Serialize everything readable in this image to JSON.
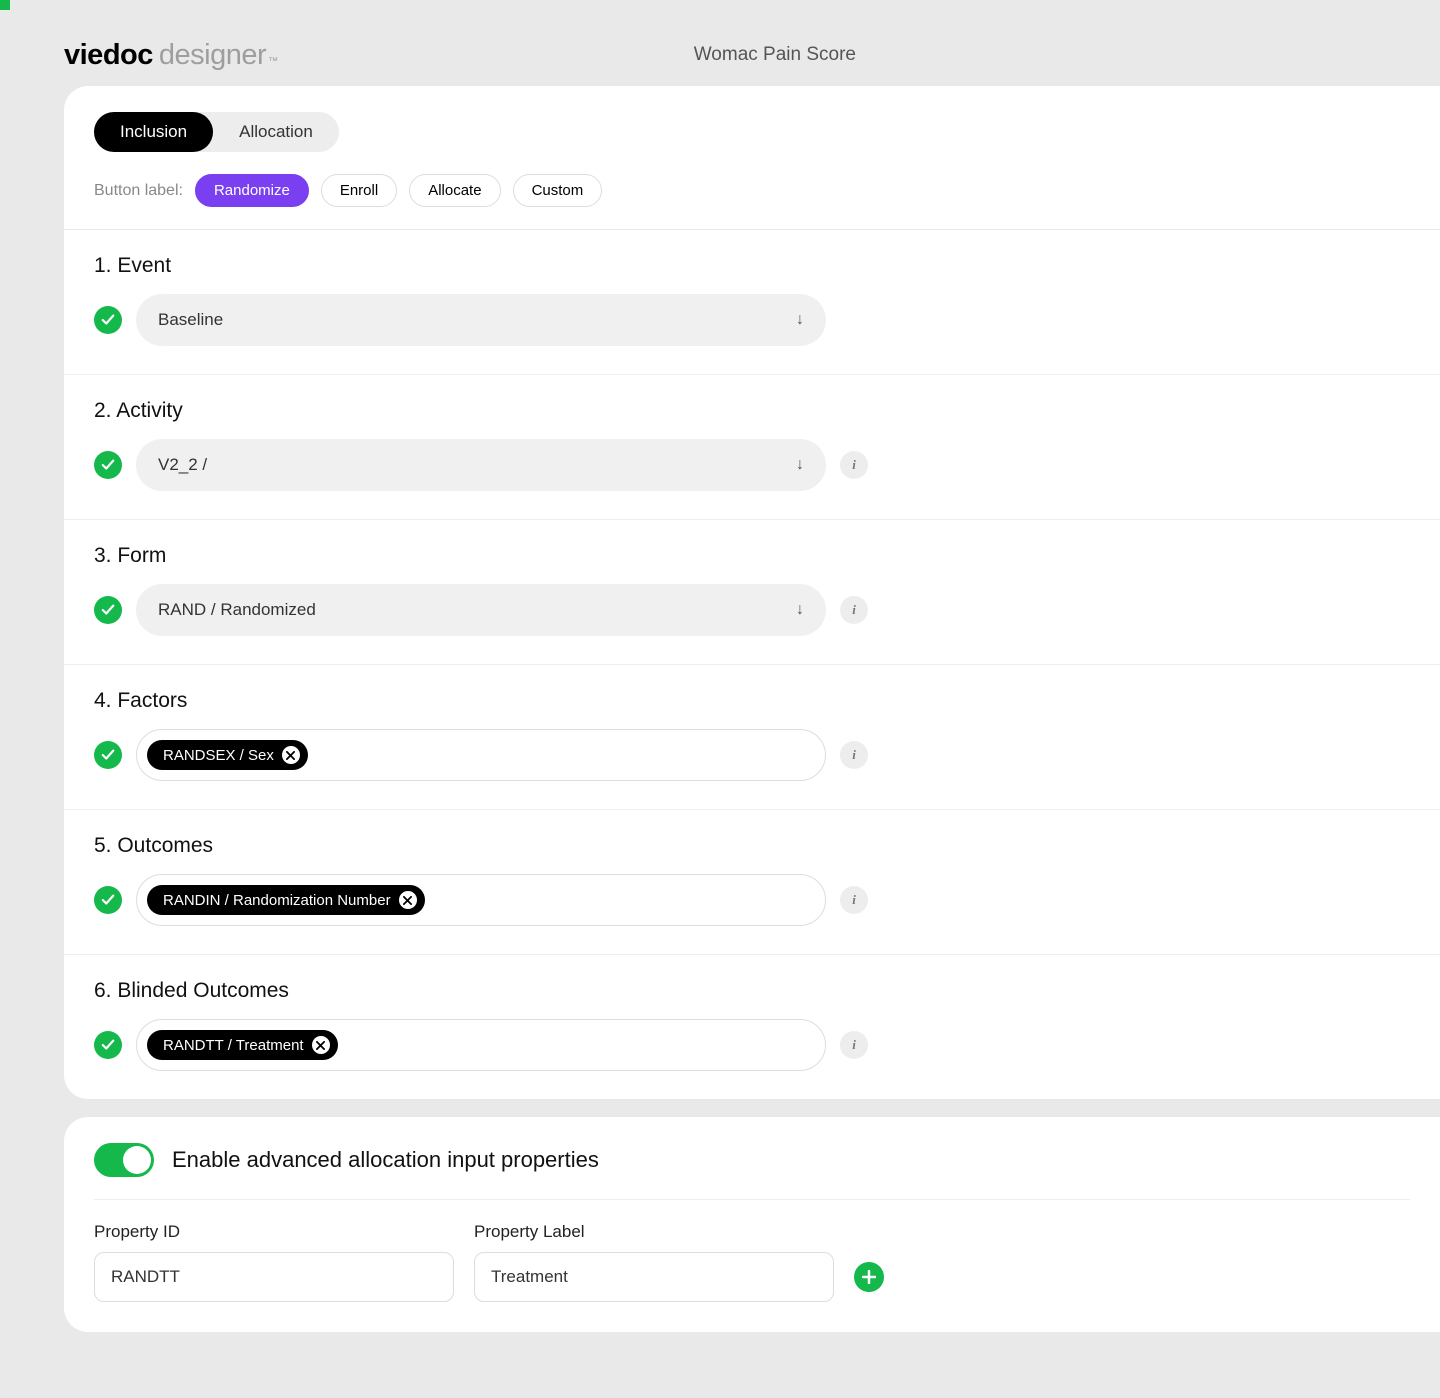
{
  "header": {
    "logo_bold": "viedoc",
    "logo_light": "designer",
    "page_title": "Womac Pain Score"
  },
  "tabs": {
    "inclusion": "Inclusion",
    "allocation": "Allocation"
  },
  "button_label": {
    "prefix": "Button label:",
    "options": [
      "Randomize",
      "Enroll",
      "Allocate",
      "Custom"
    ]
  },
  "sections": {
    "event": {
      "title": "1. Event",
      "value": "Baseline"
    },
    "activity": {
      "title": "2. Activity",
      "value": "V2_2 /"
    },
    "form": {
      "title": "3. Form",
      "value": "RAND / Randomized"
    },
    "factors": {
      "title": "4. Factors",
      "tag": "RANDSEX / Sex"
    },
    "outcomes": {
      "title": "5. Outcomes",
      "tag": "RANDIN / Randomization Number"
    },
    "blinded": {
      "title": "6. Blinded Outcomes",
      "tag": "RANDTT / Treatment"
    }
  },
  "advanced": {
    "toggle_label": "Enable advanced allocation input properties",
    "property_id_label": "Property ID",
    "property_id_value": "RANDTT",
    "property_label_label": "Property Label",
    "property_label_value": "Treatment"
  }
}
